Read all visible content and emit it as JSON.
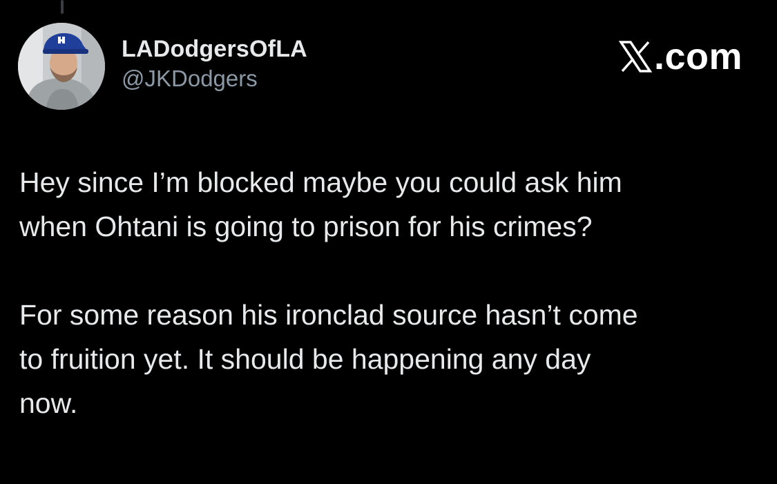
{
  "colors": {
    "background": "#000000",
    "text_primary": "#e7e9ea",
    "text_secondary": "#8b98a5",
    "brand": "#ffffff"
  },
  "tweet": {
    "author": {
      "display_name": "LADodgersOfLA",
      "handle": "@JKDodgers",
      "avatar_icon": "profile-photo-dodgers-cap"
    },
    "paragraphs": [
      "Hey since I’m blocked maybe you could ask him\nwhen Ohtani is going to prison for his crimes?",
      "For some reason his ironclad source hasn’t come\nto fruition yet. It should be happening any day\nnow."
    ]
  },
  "watermark": {
    "logo_icon": "x-logo-icon",
    "text": ".com"
  }
}
